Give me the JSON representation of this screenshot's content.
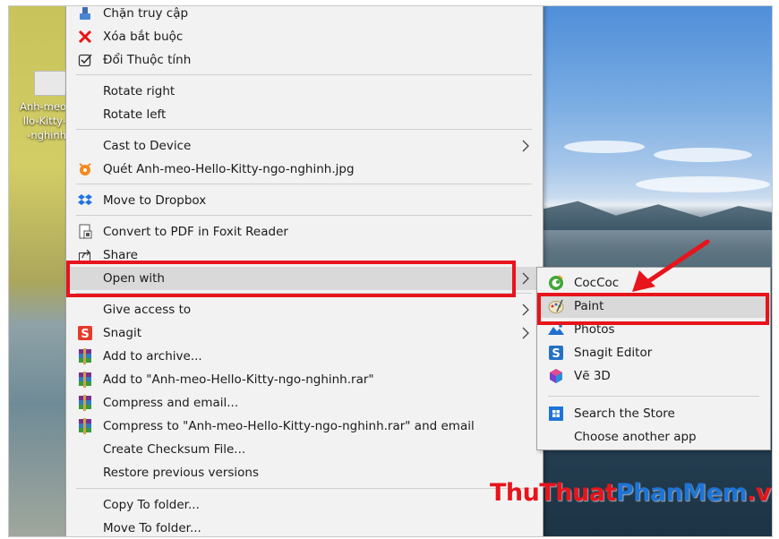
{
  "desktop": {
    "file_label_lines": [
      "Anh-meo",
      "llo-Kitty-",
      "-nghinh"
    ]
  },
  "context_menu": {
    "items": [
      {
        "label": "Chặn truy cập",
        "icon": "broom-icon"
      },
      {
        "label": "Xóa bắt buộc",
        "icon": "red-x-icon"
      },
      {
        "label": "Đổi Thuộc tính",
        "icon": "checkbox-icon"
      },
      {
        "label": "Rotate right"
      },
      {
        "label": "Rotate left"
      },
      {
        "label": "Cast to Device",
        "submenu": true
      },
      {
        "label": "Quét Anh-meo-Hello-Kitty-ngo-nghinh.jpg",
        "icon": "coccoc-scan-icon"
      },
      {
        "label": "Move to Dropbox",
        "icon": "dropbox-icon"
      },
      {
        "label": "Convert to PDF in Foxit Reader",
        "icon": "foxit-icon"
      },
      {
        "label": "Share",
        "icon": "share-icon"
      },
      {
        "label": "Open with",
        "submenu": true,
        "highlighted": true
      },
      {
        "label": "Give access to",
        "submenu": true
      },
      {
        "label": "Snagit",
        "icon": "snagit-icon",
        "submenu": true
      },
      {
        "label": "Add to archive...",
        "icon": "winrar-icon"
      },
      {
        "label": "Add to \"Anh-meo-Hello-Kitty-ngo-nghinh.rar\"",
        "icon": "winrar-icon"
      },
      {
        "label": "Compress and email...",
        "icon": "winrar-icon"
      },
      {
        "label": "Compress to \"Anh-meo-Hello-Kitty-ngo-nghinh.rar\" and email",
        "icon": "winrar-icon"
      },
      {
        "label": "Create Checksum File..."
      },
      {
        "label": "Restore previous versions"
      },
      {
        "label": "Copy To folder..."
      },
      {
        "label": "Move To folder..."
      }
    ]
  },
  "open_with_submenu": {
    "items": [
      {
        "label": "CocCoc",
        "icon": "coccoc-icon"
      },
      {
        "label": "Paint",
        "icon": "paint-icon",
        "highlighted": true
      },
      {
        "label": "Photos",
        "icon": "photos-icon"
      },
      {
        "label": "Snagit Editor",
        "icon": "snagit-icon"
      },
      {
        "label": "Vẽ 3D",
        "icon": "paint3d-icon"
      },
      {
        "label": "Search the Store",
        "icon": "store-icon"
      },
      {
        "label": "Choose another app"
      }
    ]
  },
  "watermark": {
    "part1": "ThuThuat",
    "part2": "PhanMem",
    "part3": ".vn"
  },
  "colors": {
    "annotation_red": "#e8141b",
    "menu_bg": "#f2f2f2",
    "highlight_bg": "#d9d9d9"
  }
}
